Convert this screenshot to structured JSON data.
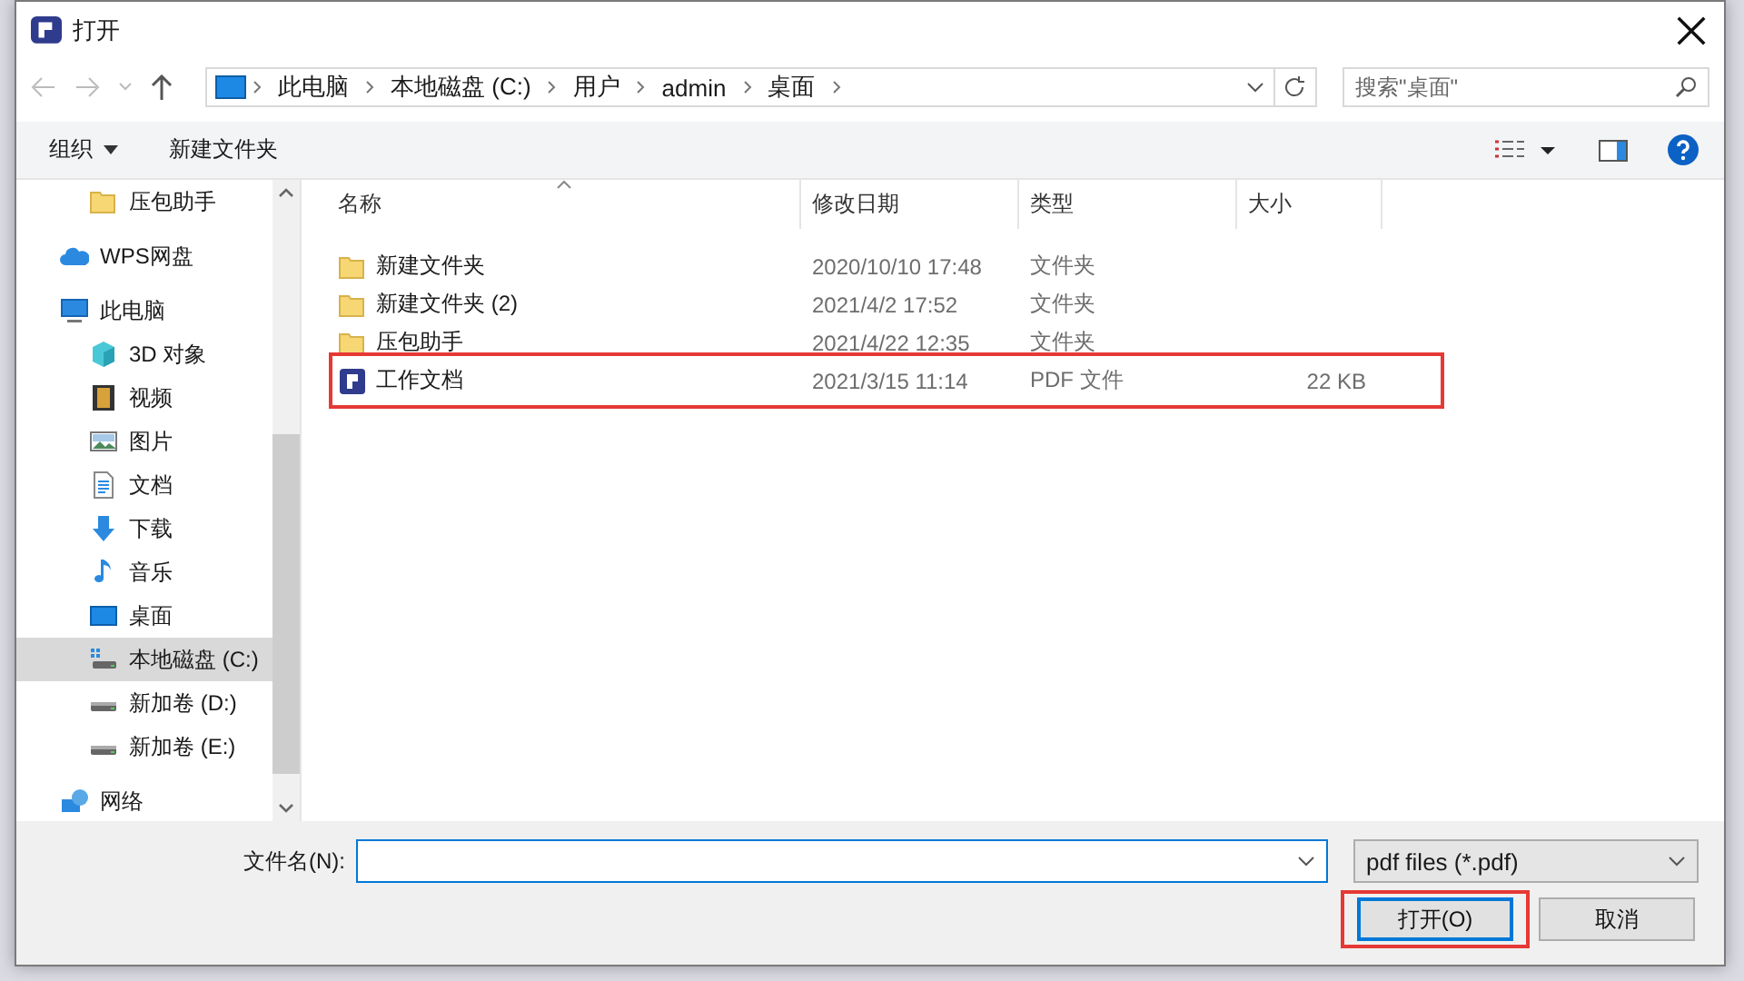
{
  "window": {
    "title": "打开"
  },
  "address": {
    "segments": [
      "此电脑",
      "本地磁盘 (C:)",
      "用户",
      "admin",
      "桌面"
    ],
    "search": {
      "placeholder": "搜索\"桌面\""
    }
  },
  "toolbar": {
    "organize": "组织",
    "new_folder": "新建文件夹"
  },
  "sidebar": {
    "items": [
      {
        "label": "压包助手",
        "kind": "folder",
        "selected": false,
        "indent": true
      },
      {
        "label": "WPS网盘",
        "kind": "cloud",
        "selected": false
      },
      {
        "label": "此电脑",
        "kind": "pc",
        "selected": false,
        "children": [
          {
            "label": "3D 对象",
            "kind": "cube",
            "selected": false
          },
          {
            "label": "视频",
            "kind": "video",
            "selected": false
          },
          {
            "label": "图片",
            "kind": "image",
            "selected": false
          },
          {
            "label": "文档",
            "kind": "doc",
            "selected": false
          },
          {
            "label": "下载",
            "kind": "download",
            "selected": false
          },
          {
            "label": "音乐",
            "kind": "music",
            "selected": false
          },
          {
            "label": "桌面",
            "kind": "desktop",
            "selected": false
          },
          {
            "label": "本地磁盘 (C:)",
            "kind": "system-drive",
            "selected": true
          },
          {
            "label": "新加卷 (D:)",
            "kind": "drive",
            "selected": false
          },
          {
            "label": "新加卷 (E:)",
            "kind": "drive",
            "selected": false
          }
        ]
      },
      {
        "label": "网络",
        "kind": "network",
        "selected": false
      }
    ]
  },
  "table": {
    "columns": [
      "名称",
      "修改日期",
      "类型",
      "大小"
    ],
    "rows": [
      {
        "name": "新建文件夹",
        "date": "2020/10/10 17:48",
        "type": "文件夹",
        "kind": "folder",
        "highlighted": false
      },
      {
        "name": "新建文件夹 (2)",
        "date": "2021/4/2 17:52",
        "type": "文件夹",
        "kind": "folder",
        "highlighted": false
      },
      {
        "name": "压包助手",
        "date": "2021/4/22 12:35",
        "type": "文件夹",
        "kind": "folder",
        "highlighted": false
      },
      {
        "name": "工作文档",
        "date": "2021/3/15 11:14",
        "type": "PDF 文件",
        "size": "22 KB",
        "kind": "pdf",
        "highlighted": true
      }
    ]
  },
  "footer": {
    "filename_label": "文件名(N):",
    "filter": "pdf files (*.pdf)",
    "buttons": [
      {
        "label": "打开(O)",
        "default": true,
        "highlighted": true
      },
      {
        "label": "取消",
        "default": false,
        "highlighted": false
      }
    ]
  }
}
